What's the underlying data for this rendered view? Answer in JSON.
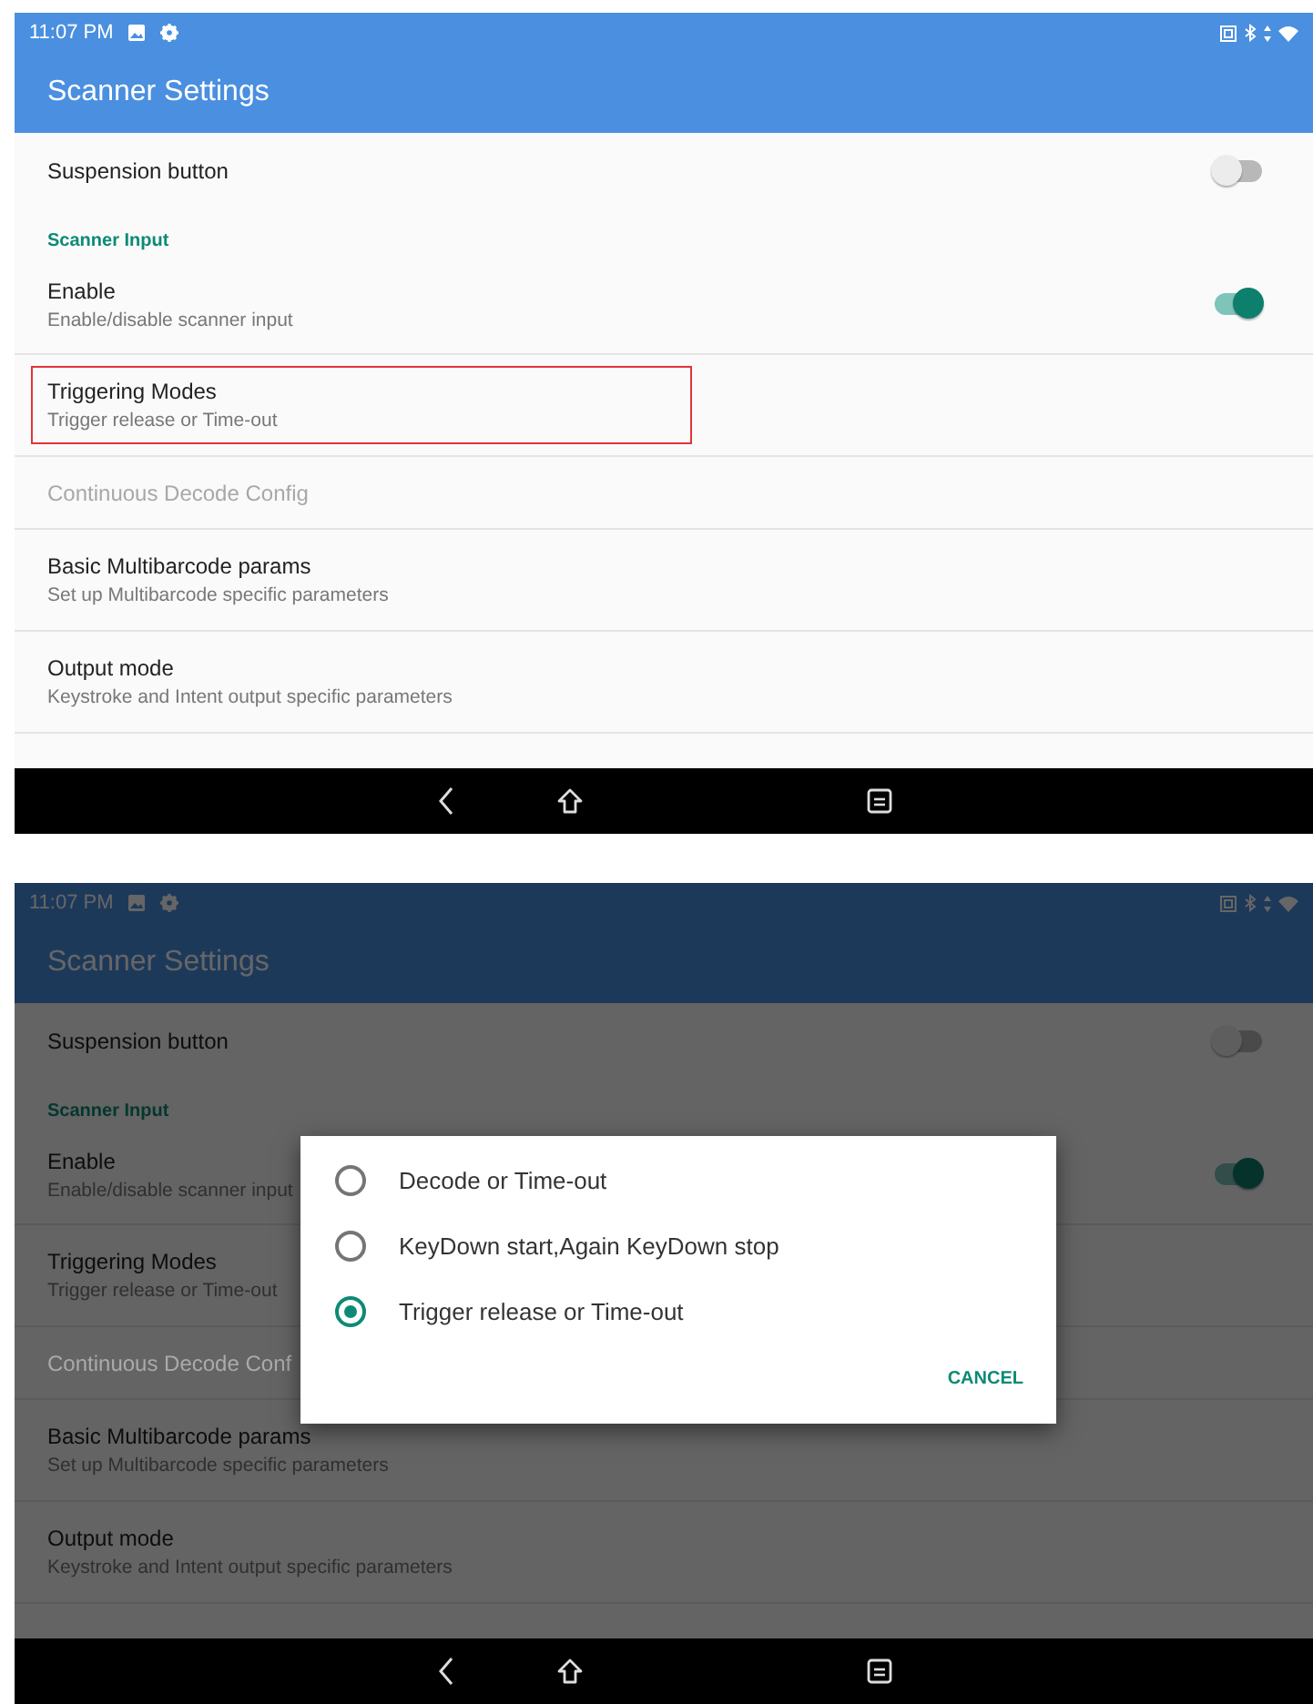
{
  "screens": [
    {
      "dimmed": false,
      "status_bar": {
        "time": "11:07 PM"
      },
      "app_bar": {
        "title": "Scanner Settings"
      },
      "items": [
        {
          "kind": "switch",
          "title": "Suspension button",
          "on": false
        },
        {
          "kind": "header",
          "title": "Scanner Input"
        },
        {
          "kind": "switch",
          "title": "Enable",
          "summary": "Enable/disable scanner input",
          "on": true
        },
        {
          "kind": "preference",
          "title": "Triggering Modes",
          "summary": "Trigger release or Time-out",
          "highlighted": true,
          "disabled": false
        },
        {
          "kind": "preference",
          "title": "Continuous Decode Config",
          "highlighted": false,
          "disabled": true
        },
        {
          "kind": "preference",
          "title": "Basic Multibarcode params",
          "summary": "Set up Multibarcode specific parameters",
          "highlighted": false,
          "disabled": false
        },
        {
          "kind": "preference",
          "title": "Output mode",
          "summary": "Keystroke and Intent output specific parameters",
          "highlighted": false,
          "disabled": false
        }
      ]
    },
    {
      "dimmed": true,
      "status_bar": {
        "time": "11:07 PM"
      },
      "app_bar": {
        "title": "Scanner Settings"
      },
      "items": [
        {
          "kind": "switch",
          "title": "Suspension button",
          "on": false
        },
        {
          "kind": "header",
          "title": "Scanner Input"
        },
        {
          "kind": "switch",
          "title": "Enable",
          "summary": "Enable/disable scanner input",
          "on": true
        },
        {
          "kind": "preference",
          "title": "Triggering Modes",
          "summary": "Trigger release or Time-out",
          "highlighted": false,
          "disabled": false
        },
        {
          "kind": "preference",
          "title": "Continuous Decode Conf",
          "highlighted": false,
          "disabled": true
        },
        {
          "kind": "preference",
          "title": "Basic Multibarcode params",
          "summary": "Set up Multibarcode specific parameters",
          "highlighted": false,
          "disabled": false
        },
        {
          "kind": "preference",
          "title": "Output mode",
          "summary": "Keystroke and Intent output specific parameters",
          "highlighted": false,
          "disabled": false
        }
      ],
      "dialog": {
        "options": [
          {
            "label": "Decode or Time-out",
            "selected": false
          },
          {
            "label": "KeyDown start,Again KeyDown stop",
            "selected": false
          },
          {
            "label": "Trigger release or Time-out",
            "selected": true
          }
        ],
        "button": "CANCEL"
      }
    }
  ]
}
